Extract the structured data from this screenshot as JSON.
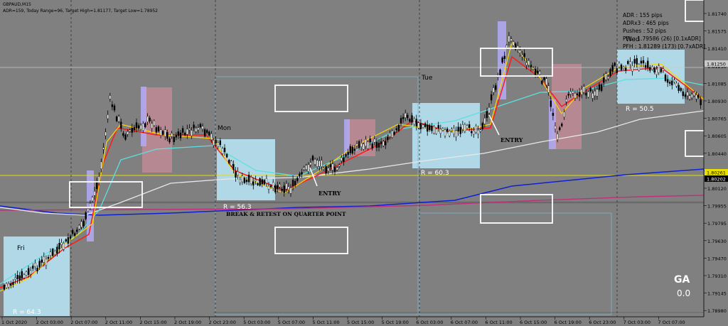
{
  "header": {
    "symbol": "GBPAUD,M15",
    "info": "ADR=159, Today Range=96, Target High=1.81177, Target Low=1.78952"
  },
  "stats_panel": {
    "lines": [
      "ADR : 155 pips",
      "ADRx3 : 465 pips",
      "Pushes : 52 pips",
      "PFL : 1.79586 (26) [0.1xADR]",
      "PFH : 1.81289 (173) [0.7xADR]"
    ],
    "top_label": "Wed"
  },
  "annotations": {
    "day_labels": [
      "Fri",
      "Mon",
      "Tue",
      "Wed"
    ],
    "r_labels": [
      "R = 64.3",
      "R = 56.3",
      "R = 60.3",
      "R = 50.5"
    ],
    "entry1": "ENTRY",
    "entry2": "ENTRY",
    "break_retest": "BREAK & RETEST ON QUARTER POINT",
    "ga_label": "GA",
    "ga_value": "0.0"
  },
  "price_axis": {
    "ticks": [
      "1.81740",
      "1.81575",
      "1.81410",
      "1.81250",
      "1.81085",
      "1.80930",
      "1.80765",
      "1.80605",
      "1.80440",
      "1.80280",
      "1.80120",
      "1.79955",
      "1.79795",
      "1.79630",
      "1.79470",
      "1.79310",
      "1.79145",
      "1.78980"
    ],
    "badges": [
      "1.81250",
      "1.80261",
      "1.80202"
    ]
  },
  "time_axis": {
    "ticks": [
      "1 Oct 2020",
      "2 Oct 03:00",
      "2 Oct 07:00",
      "2 Oct 11:00",
      "2 Oct 15:00",
      "2 Oct 19:00",
      "2 Oct 23:00",
      "5 Oct 03:00",
      "5 Oct 07:00",
      "5 Oct 11:00",
      "5 Oct 15:00",
      "5 Oct 19:00",
      "6 Oct 03:00",
      "6 Oct 07:00",
      "6 Oct 11:00",
      "6 Oct 15:00",
      "6 Oct 19:00",
      "6 Oct 23:00",
      "7 Oct 03:00",
      "7 Oct 07:00"
    ]
  },
  "colors": {
    "background": "#808080",
    "bull_candle": "#000000",
    "ema_fast": "#ffd700",
    "ema_red": "#ff1a1a",
    "ema_cyan": "#5ce0e0",
    "ema_white": "#e8e8e8",
    "ma_blue": "#1020d0",
    "ma_magenta": "#c0307a",
    "session_box": "#b8e8f8",
    "supply_zone": "#c88c98"
  }
}
